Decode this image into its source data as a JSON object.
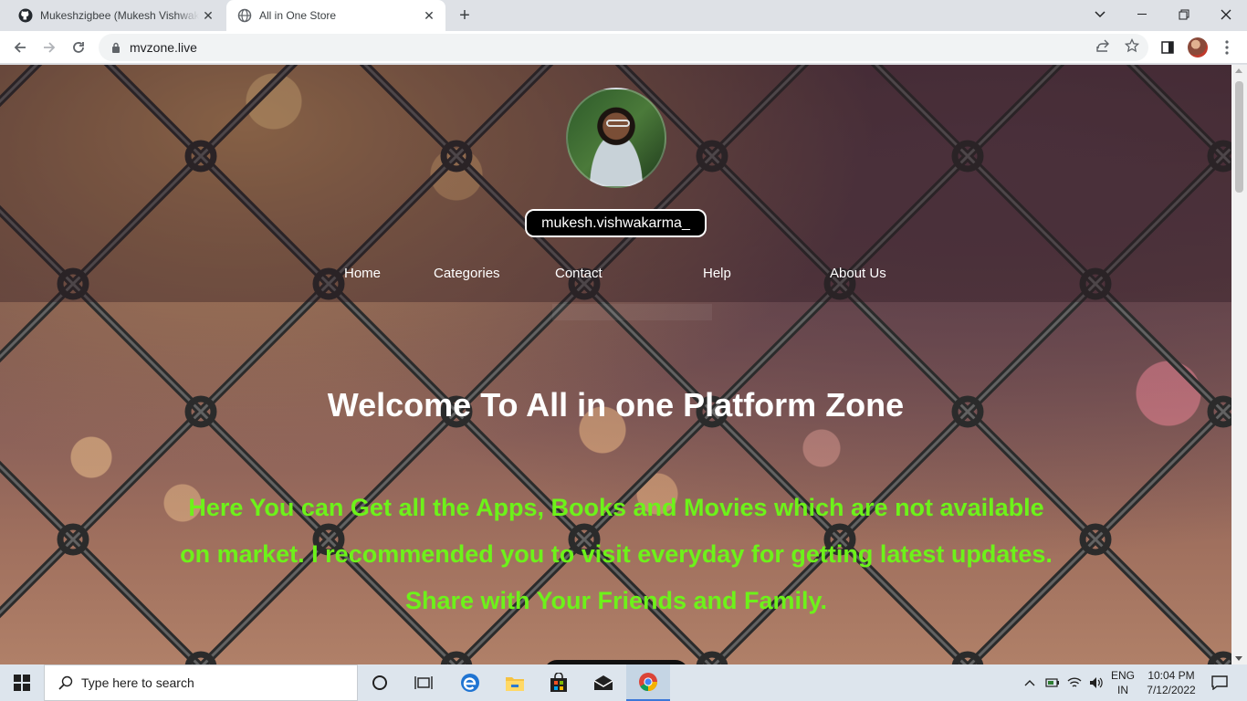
{
  "browser": {
    "tabs": [
      {
        "title": "Mukeshzigbee (Mukesh Vishwakarma)",
        "active": false,
        "favicon": "github-icon"
      },
      {
        "title": "All in One Store",
        "active": true,
        "favicon": "globe-icon"
      }
    ],
    "url": "mvzone.live"
  },
  "site": {
    "username": "mukesh.vishwakarma_",
    "nav": [
      "Home",
      "Categories",
      "Contact",
      "Help",
      "About Us"
    ],
    "welcome": "Welcome To All in one Platform Zone",
    "tagline": "Here You can Get all the Apps, Books and Movies which are not available on market. I recommended you to visit everyday for getting latest updates. Share with Your Friends and Family.",
    "colors": {
      "tagline": "#6df21a",
      "heading": "#ffffff",
      "pill_bg": "#000000"
    }
  },
  "taskbar": {
    "search_placeholder": "Type here to search",
    "lang_top": "ENG",
    "lang_bottom": "IN",
    "time": "10:04 PM",
    "date": "7/12/2022"
  }
}
